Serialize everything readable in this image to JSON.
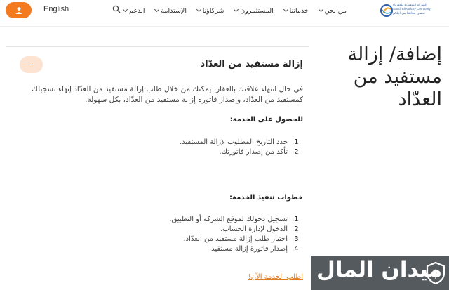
{
  "header": {
    "language_label": "English",
    "nav": [
      {
        "label": "من نحن",
        "icon": "chevron-down-icon"
      },
      {
        "label": "خدماتنا",
        "icon": "chevron-down-icon"
      },
      {
        "label": "المستثمرون",
        "icon": "chevron-down-icon"
      },
      {
        "label": "شركاؤنا",
        "icon": "chevron-down-icon"
      },
      {
        "label": "الإستدامة",
        "icon": "chevron-down-icon"
      },
      {
        "label": "الدعم",
        "icon": "chevron-down-icon"
      }
    ],
    "logo": {
      "arabic_name": "الشركة السعودية للكهرباء",
      "english_name": "Saudi Electricity Company",
      "tagline": "نحسن بطاقتنا من أجلكم"
    },
    "accent_color": "#f47a20"
  },
  "page": {
    "title": "إضافة/ إزالة مستفيد من العدّاد"
  },
  "service": {
    "collapse_symbol": "–",
    "title": "إزالة مستفيد من العدّاد",
    "intro": "في حال انتهاء علاقتك بالعقار، يمكنك من خلال طلب إزالة مستفيد من العدّاد إنهاء تسجيلك كمستفيد من العدّاد، وإصدار فاتورة إزالة مستفيد من العدّاد، بكل سهولة.",
    "requirements_heading": "للحصول على الخدمة:",
    "requirements": [
      {
        "num": "1.",
        "text": "حدد التاريخ المطلوب لإزالة المستفيد."
      },
      {
        "num": "2.",
        "text": "تأكد من إصدار فاتورتك."
      }
    ],
    "steps_heading": "خطوات تنفيذ الخدمة:",
    "steps": [
      {
        "num": "1.",
        "text": "تسجيل دخولك لموقع الشركة أو التطبيق."
      },
      {
        "num": "2.",
        "text": "الدخول لإدارة الحساب."
      },
      {
        "num": "3.",
        "text": "اختيار طلب إزالة مستفيد من العدّاد."
      },
      {
        "num": "4.",
        "text": "إصدار فاتورة إزالة مستفيد."
      }
    ],
    "cta_label": "اطلب الخدمة الآن!"
  },
  "watermark": {
    "text": "ميدان المال",
    "badge_icon": "dollar-shield-icon"
  }
}
